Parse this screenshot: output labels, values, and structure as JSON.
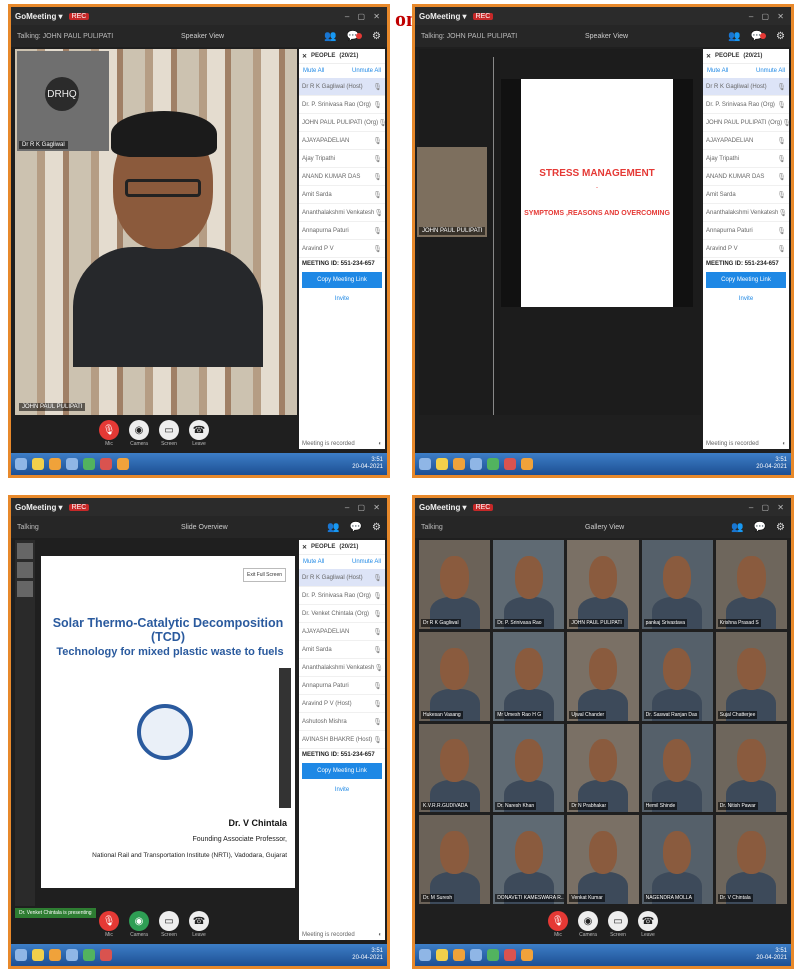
{
  "page": {
    "corner_title": "on"
  },
  "common": {
    "app_name": "GoMeeting ▾",
    "rec_label": "REC",
    "window_controls": "– ▢ ✕",
    "taskbar_time": "3:51",
    "taskbar_date": "20-04-2021"
  },
  "controls": {
    "mic": "Mic",
    "camera": "Camera",
    "screen": "Screen",
    "leave": "Leave"
  },
  "panel": {
    "title": "PEOPLE",
    "count": "(20/21)",
    "mute_all": "Mute All",
    "unmute_all": "Unmute All",
    "meeting_id": "MEETING ID: 551-234-657",
    "copy_button": "Copy Meeting Link",
    "invite": "Invite",
    "recording_note": "Meeting is recorded"
  },
  "shot1": {
    "info_left": "Talking: JOHN PAUL PULIPATI",
    "info_center": "Speaker View",
    "pip_logo": "DRHQ",
    "pip_name": "Dr R K Gagliwal",
    "self_name": "JOHN PAUL PULIPATI",
    "participants": [
      "Dr R K Gagliwal (Host)",
      "Dr. P. Srinivasa Rao (Org)",
      "JOHN PAUL PULIPATI (Org)",
      "AJAYAPADELIAN",
      "Ajay Tripathi",
      "ANAND KUMAR DAS",
      "Amit Sarda",
      "Ananthalakshmi Venkatesh",
      "Annapurna Paturi",
      "Aravind P V"
    ]
  },
  "shot2": {
    "info_left": "Talking: JOHN PAUL PULIPATI",
    "info_center": "Speaker View",
    "slide_title": "STRESS MANAGEMENT",
    "slide_dash": "-",
    "slide_sub": "SYMPTOMS ,REASONS AND OVERCOMING",
    "thumb_name": "JOHN PAUL PULIPATI"
  },
  "shot3": {
    "info_left": "Talking",
    "info_center": "Slide Overview",
    "fullscreen_tip": "Exit Full Screen",
    "title_line1": "Solar Thermo-Catalytic Decomposition (TCD)",
    "title_line2": "Technology for mixed plastic waste to fuels",
    "name": "Dr. V Chintala",
    "role": "Founding Associate Professor,",
    "institute": "National Rail and Transportation Institute (NRTI), Vadodara, Gujarat",
    "green_tag": "Dr. Venket Chintala is presenting",
    "participants": [
      "Dr R K Gagliwal (Host)",
      "Dr. P. Srinivasa Rao (Org)",
      "Dr. Venket Chintala (Org)",
      "AJAYAPADELIAN",
      "Amit Sarda",
      "Ananthalakshmi Venkatesh",
      "Annapurna Paturi",
      "Aravind P V (Host)",
      "Ashutosh Mishra",
      "AVINASH BHAKRE (Host)"
    ]
  },
  "shot4": {
    "info_left": "Talking",
    "info_center": "Gallery View",
    "tiles": [
      "Dr R K Gagliwal",
      "Dr. P. Srinivasa Rao",
      "JOHN PAUL PULIPATI",
      "pankaj Srivastava",
      "Krishna Prasad S",
      "Hukesan Vasang",
      "Mr Umesh Rao H G",
      "Ujwal Chander",
      "Dr. Saswat Ranjan Das",
      "Sujal Chatterjee",
      "K.V.R.R.GUDIVADA",
      "Dr. Naresh Khan",
      "Dr N Prabhakar",
      "Hemil Shinde",
      "Dr. Nitish Pawar",
      "Dr. M Suresh",
      "DONAVETI KAMESWARA R...",
      "Venkat Kumar",
      "NAGENDRA MOLLA",
      "Dr. V Chintala"
    ]
  }
}
